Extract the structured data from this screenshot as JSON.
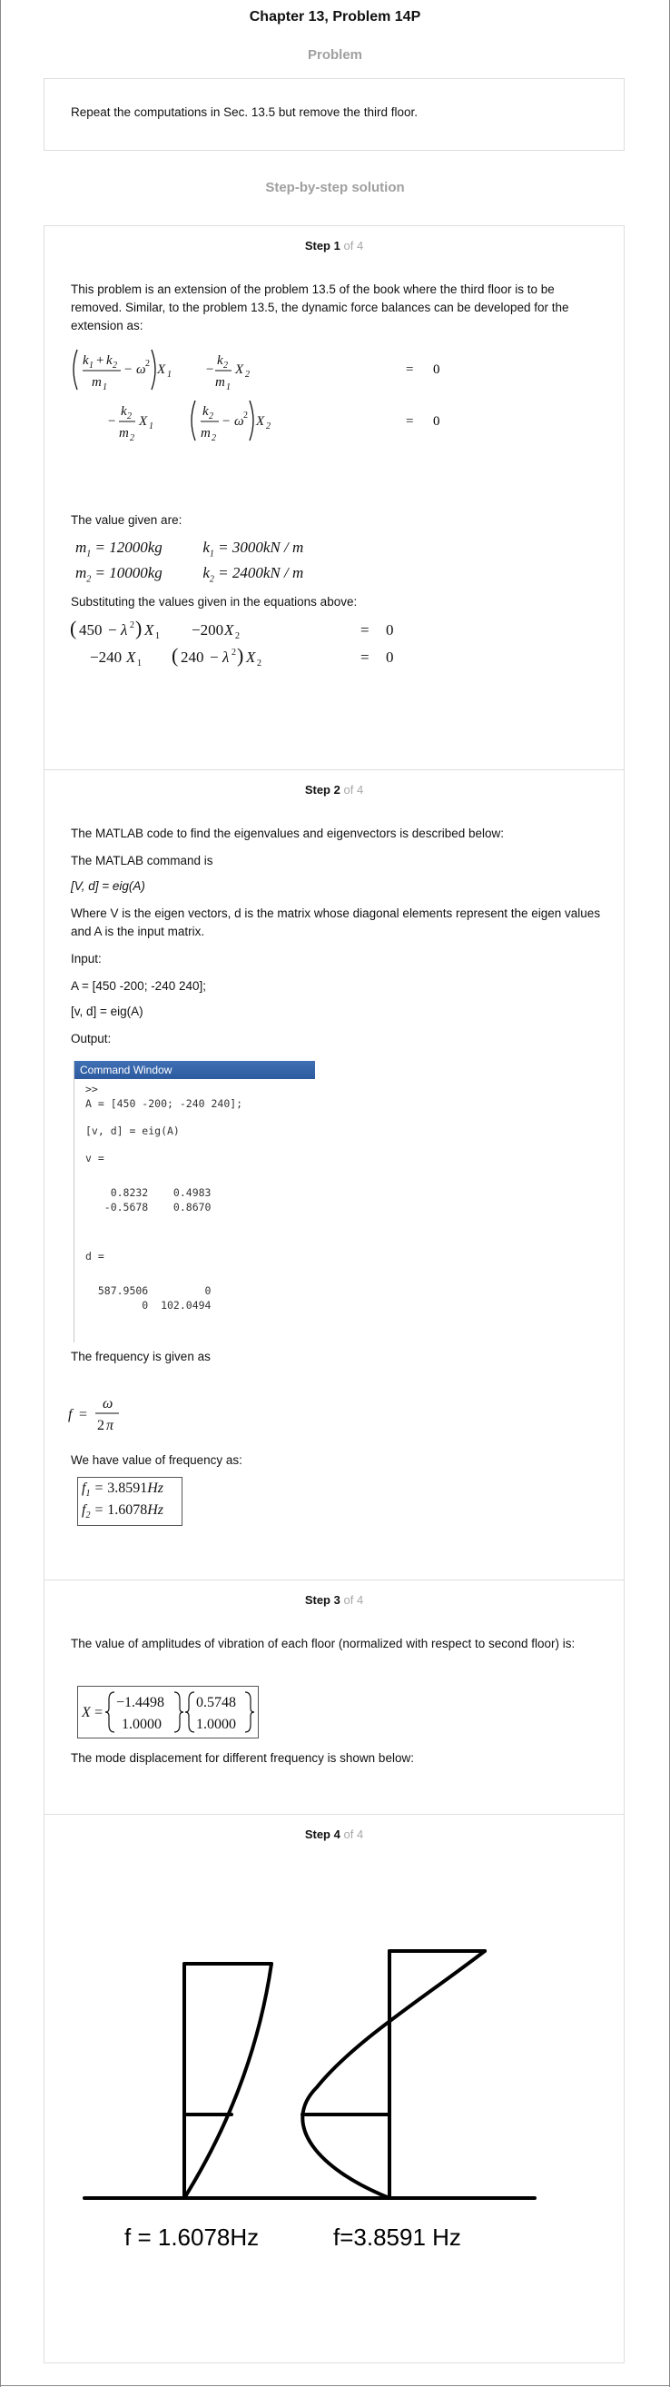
{
  "header": {
    "title": "Chapter 13, Problem 14P",
    "problem_label": "Problem",
    "problem_text": "Repeat the computations in Sec. 13.5 but remove the third floor.",
    "solution_label": "Step-by-step solution"
  },
  "steps": [
    {
      "num": "1",
      "of": "of 4",
      "intro": "This problem is an extension of the problem 13.5 of the book where the third floor is to be removed. Similar, to the problem 13.5, the dynamic force balances can be developed for the extension as:",
      "values_label": "The value given are:",
      "values": {
        "m1": "12000",
        "m2": "10000",
        "k1": "3000",
        "k2": "2400",
        "mass_unit": "kg",
        "stiff_unit": "kN / m"
      },
      "subst_label": "Substituting the values given in the equations above:",
      "eq1": {
        "a": "450",
        "b": "−200",
        "rhs": "0"
      },
      "eq2": {
        "a": "−240",
        "b": "240",
        "rhs": "0"
      }
    },
    {
      "num": "2",
      "of": "of 4",
      "intro": "The MATLAB code to find the eigenvalues and eigenvectors is described below:",
      "cmd_label": "The MATLAB command is",
      "cmd": "[V, d] = eig(A)",
      "where": "Where V is the eigen vectors, d is the matrix whose diagonal elements represent the eigen values and A is the input matrix.",
      "input_label": "Input:",
      "input_line1": "A = [450 -200; -240 240];",
      "input_line2": "[v, d] = eig(A)",
      "output_label": "Output:",
      "window": {
        "title": "Command Window",
        "lines": [
          ">>",
          "A = [450 -200; -240 240];",
          "[v, d] = eig(A)",
          "v =",
          "    0.8232    0.4983",
          "   -0.5678    0.8670",
          "d =",
          "  587.9506         0",
          "         0  102.0494"
        ]
      },
      "freq_label": "The frequency is given as",
      "freq_have": "We have value of frequency as:",
      "f1": "3.8591",
      "f2": "1.6078",
      "hz": "Hz"
    },
    {
      "num": "3",
      "of": "of 4",
      "text": "The value of amplitudes of vibration of each floor (normalized with respect to second floor) is:",
      "vec1": [
        "−1.4498",
        "1.0000"
      ],
      "vec2": [
        "0.5748",
        "1.0000"
      ],
      "mode_text": "The mode displacement for different frequency is shown below:"
    },
    {
      "num": "4",
      "of": "of 4",
      "label_low": "f = 1.6078Hz",
      "label_high": "f=3.8591 Hz"
    }
  ]
}
